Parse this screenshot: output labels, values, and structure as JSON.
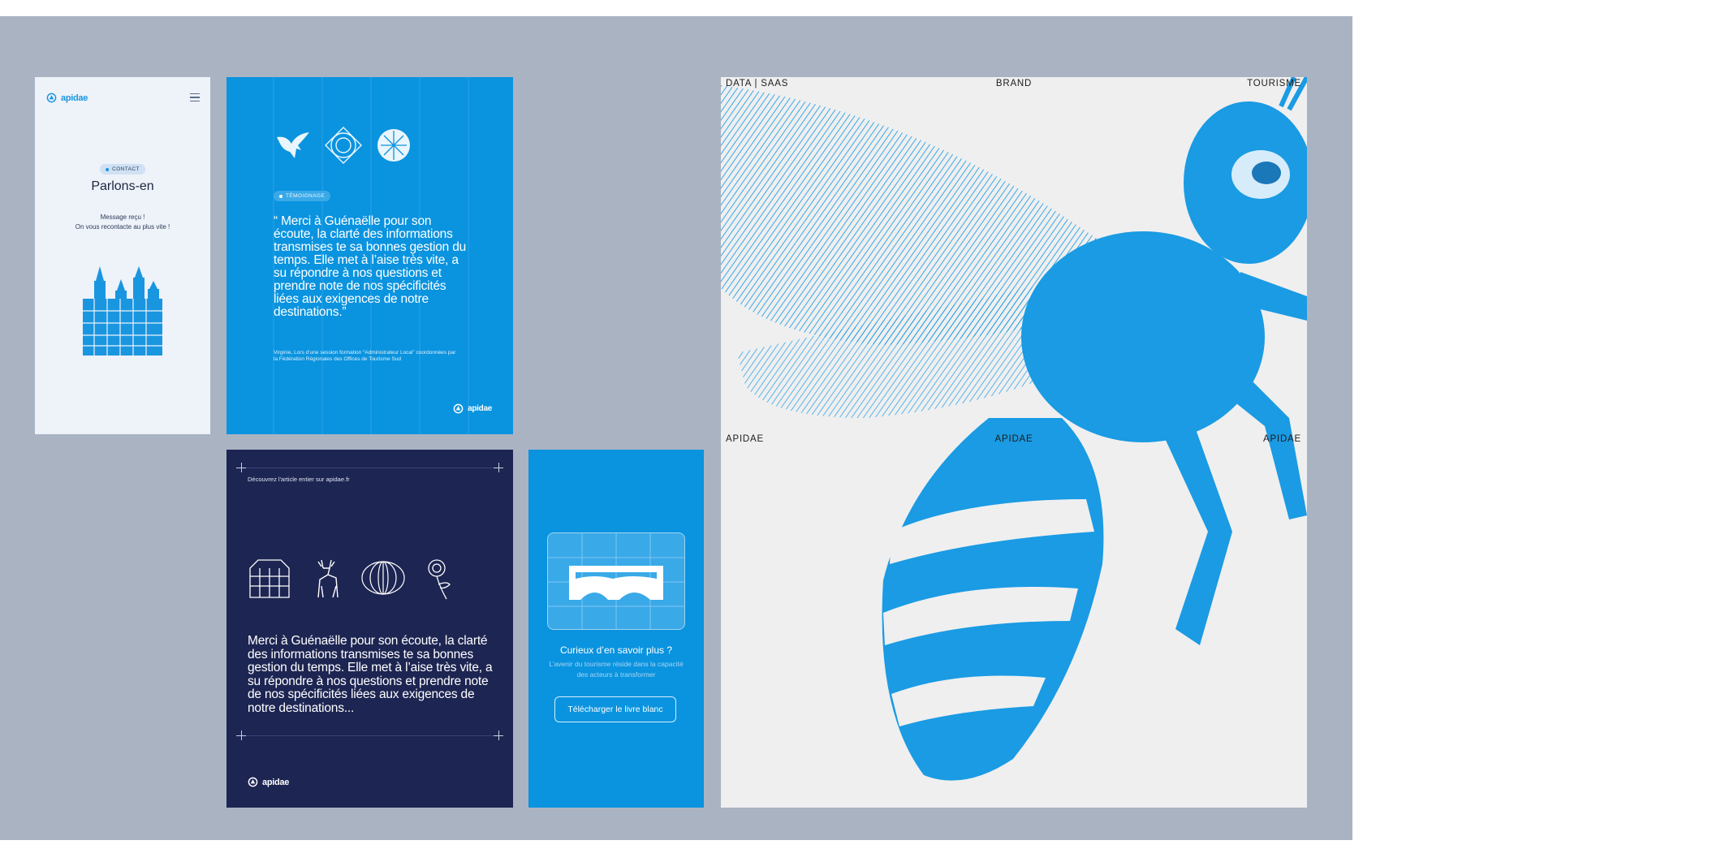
{
  "contact_card": {
    "logo_text": "apidae",
    "pill": "CONTACT",
    "title": "Parlons-en",
    "message_line1": "Message reçu !",
    "message_line2": "On vous recontacte au plus vite !"
  },
  "testimonial_card": {
    "pill": "TÉMOIGNAGE",
    "quote": "“ Merci à Guénaëlle pour son écoute, la clarté des informations transmises te sa bonnes gestion du temps. Elle met à l’aise très vite, a su répondre à nos questions et prendre note de nos spécificités liées aux exigences de notre destinations.”",
    "source": "Virginie, Lors d’une session formation “Administrateur Local” coordonnées par la Fédération Régionales des Offices de Tourisme Sud",
    "logo_text": "apidae"
  },
  "article_card": {
    "lead": "Découvrez l'article entier sur apidae.fr",
    "body": "Merci à Guénaëlle pour son écoute, la clarté des informations transmises te sa bonnes gestion du temps. Elle met à l’aise très vite, a su répondre à nos questions et prendre note de nos spécificités liées aux exigences de notre destinations...",
    "logo_text": "apidae"
  },
  "cta_card": {
    "title": "Curieux d’en savoir plus ?",
    "description": "L’avenir du tourisme réside dans la capacité des acteurs à transformer",
    "button_label": "Télécharger le livre blanc"
  },
  "bee_poster": {
    "top_left": "DATA | SAAS",
    "top_center": "BRAND",
    "top_right": "TOURISME",
    "mid_left": "APIDAE",
    "mid_center": "APIDAE",
    "mid_right": "APIDAE"
  },
  "colors": {
    "brand_blue": "#0a93df",
    "navy": "#1d2552",
    "canvas_gray": "#aab3c2"
  }
}
